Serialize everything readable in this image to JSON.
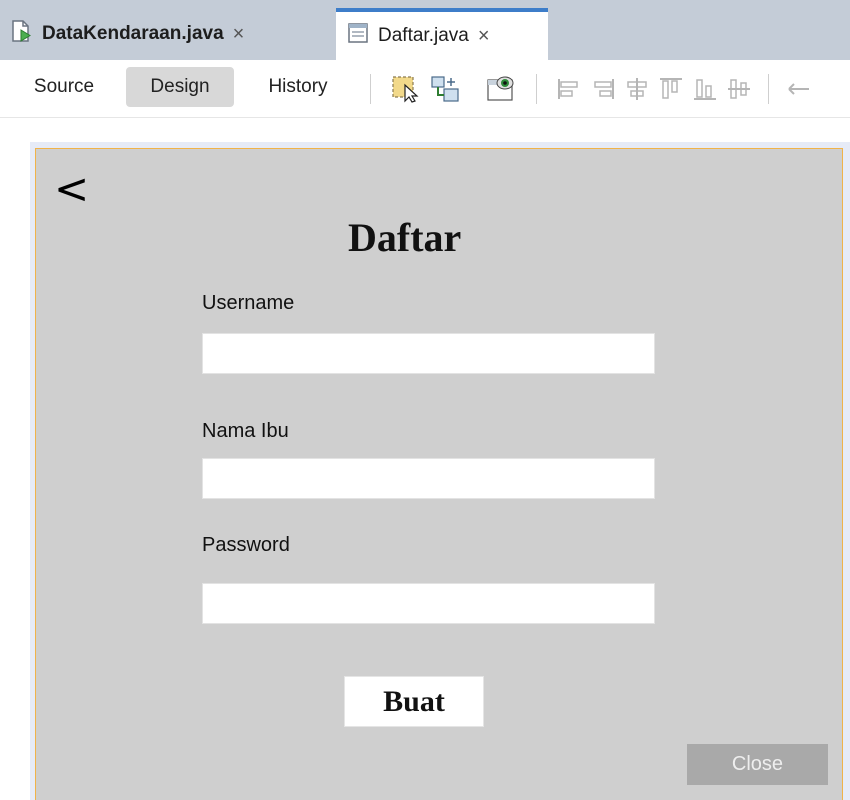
{
  "tabs": [
    {
      "label": "DataKendaraan.java",
      "close": "×",
      "active": false,
      "icon": "java-class-run-icon"
    },
    {
      "label": "Daftar.java",
      "close": "×",
      "active": true,
      "icon": "java-form-icon"
    }
  ],
  "toolbar": {
    "source_label": "Source",
    "design_label": "Design",
    "history_label": "History",
    "icons": [
      "selection-mode-icon",
      "connection-mode-icon",
      "preview-design-icon",
      "align-left-icon",
      "align-right-icon",
      "center-horizontally-icon",
      "align-top-icon",
      "align-bottom-icon",
      "center-vertically-icon",
      "change-horizontal-resizability-icon"
    ]
  },
  "form": {
    "back_label": "<",
    "title": "Daftar",
    "fields": [
      {
        "label": "Username",
        "value": ""
      },
      {
        "label": "Nama Ibu",
        "value": ""
      },
      {
        "label": "Password",
        "value": ""
      }
    ],
    "submit_label": "Buat",
    "close_label": "Close"
  },
  "colors": {
    "tabbar_bg": "#c4ccd7",
    "active_tab_accent": "#3d7dc9",
    "panel_bg": "#cfcfcf",
    "panel_border": "#f0b34a",
    "close_button_bg": "#a9a9a9"
  }
}
